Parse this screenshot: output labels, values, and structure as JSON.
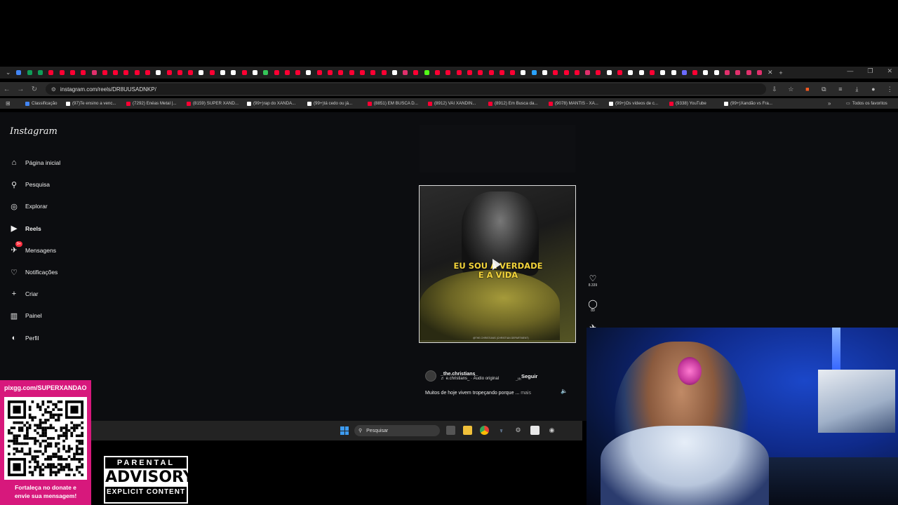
{
  "browser": {
    "tab_favicon_colors": [
      "#4285f4",
      "#0f9d58",
      "#0f9d58",
      "#ff0033",
      "#ff0033",
      "#ff0033",
      "#ff0033",
      "#e1306c",
      "#ff0033",
      "#ff0033",
      "#ff0033",
      "#ff0033",
      "#ff0033",
      "#ffffff",
      "#ff0033",
      "#ff0033",
      "#ff0033",
      "#ffffff",
      "#ff0033",
      "#ffffff",
      "#ffffff",
      "#ff0033",
      "#ffffff",
      "#35c759",
      "#ff0033",
      "#ff0033",
      "#ff0033",
      "#ffffff",
      "#ff0033",
      "#ff0033",
      "#ff0033",
      "#ff0033",
      "#ff0033",
      "#ff0033",
      "#ff0033",
      "#ffffff",
      "#e1306c",
      "#ff0033",
      "#53fc18",
      "#ff0033",
      "#ff0033",
      "#ff0033",
      "#ff0033",
      "#ff0033",
      "#ff0033",
      "#ff0033",
      "#ff0033",
      "#ffffff",
      "#2aa3ff",
      "#ffffff",
      "#ff0033",
      "#ff0033",
      "#ff0033",
      "#e1306c",
      "#ff0033",
      "#ffffff",
      "#ff0033",
      "#ffffff",
      "#ffffff",
      "#ff0033",
      "#ffffff",
      "#ffffff",
      "#6b6bff",
      "#ff0033",
      "#ffffff",
      "#ffffff",
      "#e1306c",
      "#e1306c",
      "#e1306c",
      "#e1306c"
    ],
    "address_url": "instagram.com/reels/DR8UUSADNKP/",
    "bookmarks": [
      {
        "label": "Classificação",
        "color": "#4285f4"
      },
      {
        "label": "(97)Te ensino a venc...",
        "color": "#ffffff"
      },
      {
        "label": "(7292) Enéas Metal |...",
        "color": "#ff0033"
      },
      {
        "label": "(8159) SUPER XAND...",
        "color": "#ff0033"
      },
      {
        "label": "(99+)rap do XANDÃ...",
        "color": "#ffffff"
      },
      {
        "label": "(99+)tá cedo ou já...",
        "color": "#ffffff"
      },
      {
        "label": "(8851) EM BUSCA D...",
        "color": "#ff0033"
      },
      {
        "label": "(8912) VAI XANDIN...",
        "color": "#ff0033"
      },
      {
        "label": "(8912) Em Busca da...",
        "color": "#ff0033"
      },
      {
        "label": "(9078) MANTIS - XA...",
        "color": "#ff0033"
      },
      {
        "label": "(99+)Os vídeos de c...",
        "color": "#ffffff"
      },
      {
        "label": "(9338) YouTube",
        "color": "#ff0033"
      },
      {
        "label": "(99+)Xandão vs Fra...",
        "color": "#ffffff"
      }
    ],
    "all_favorites": "Todos os favoritos"
  },
  "instagram": {
    "logo": "Instagram",
    "nav": [
      {
        "label": "Página inicial",
        "icon": "home-icon",
        "glyph": "⌂"
      },
      {
        "label": "Pesquisa",
        "icon": "search-icon",
        "glyph": "⚲"
      },
      {
        "label": "Explorar",
        "icon": "compass-icon",
        "glyph": "◎"
      },
      {
        "label": "Reels",
        "icon": "reels-icon",
        "glyph": "▶"
      },
      {
        "label": "Mensagens",
        "icon": "messenger-icon",
        "glyph": "✈",
        "badge": "9+"
      },
      {
        "label": "Notificações",
        "icon": "heart-icon",
        "glyph": "♡"
      },
      {
        "label": "Criar",
        "icon": "plus-icon",
        "glyph": "+"
      },
      {
        "label": "Painel",
        "icon": "dashboard-icon",
        "glyph": "▥"
      },
      {
        "label": "Perfil",
        "icon": "avatar-icon",
        "glyph": "◐"
      }
    ],
    "reel": {
      "caption_line1": "EU SOU A VERDADE",
      "caption_line2": "E A VIDA",
      "credit": "@THE.CHRISTIANS (CHRISTIAN DEPARTMENT)",
      "likes": "8.339",
      "comments": "89",
      "author": "_the.christians_",
      "audio": "♬ e.christians_ · Áudio original",
      "audio_snippet": "_th",
      "follow": "Seguir",
      "description": "Muitos de hoje vivem tropeçando porque ...",
      "more": "mais"
    }
  },
  "taskbar": {
    "search_placeholder": "Pesquisar"
  },
  "overlay": {
    "qr_url": "pixgg.com/SUPERXANDAO",
    "qr_caption_line1": "Fortaleça no donate e",
    "qr_caption_line2": "envie sua mensagem!",
    "advisory_top": "PARENTAL",
    "advisory_mid": "ADVISORY",
    "advisory_bot": "EXPLICIT CONTENT"
  }
}
